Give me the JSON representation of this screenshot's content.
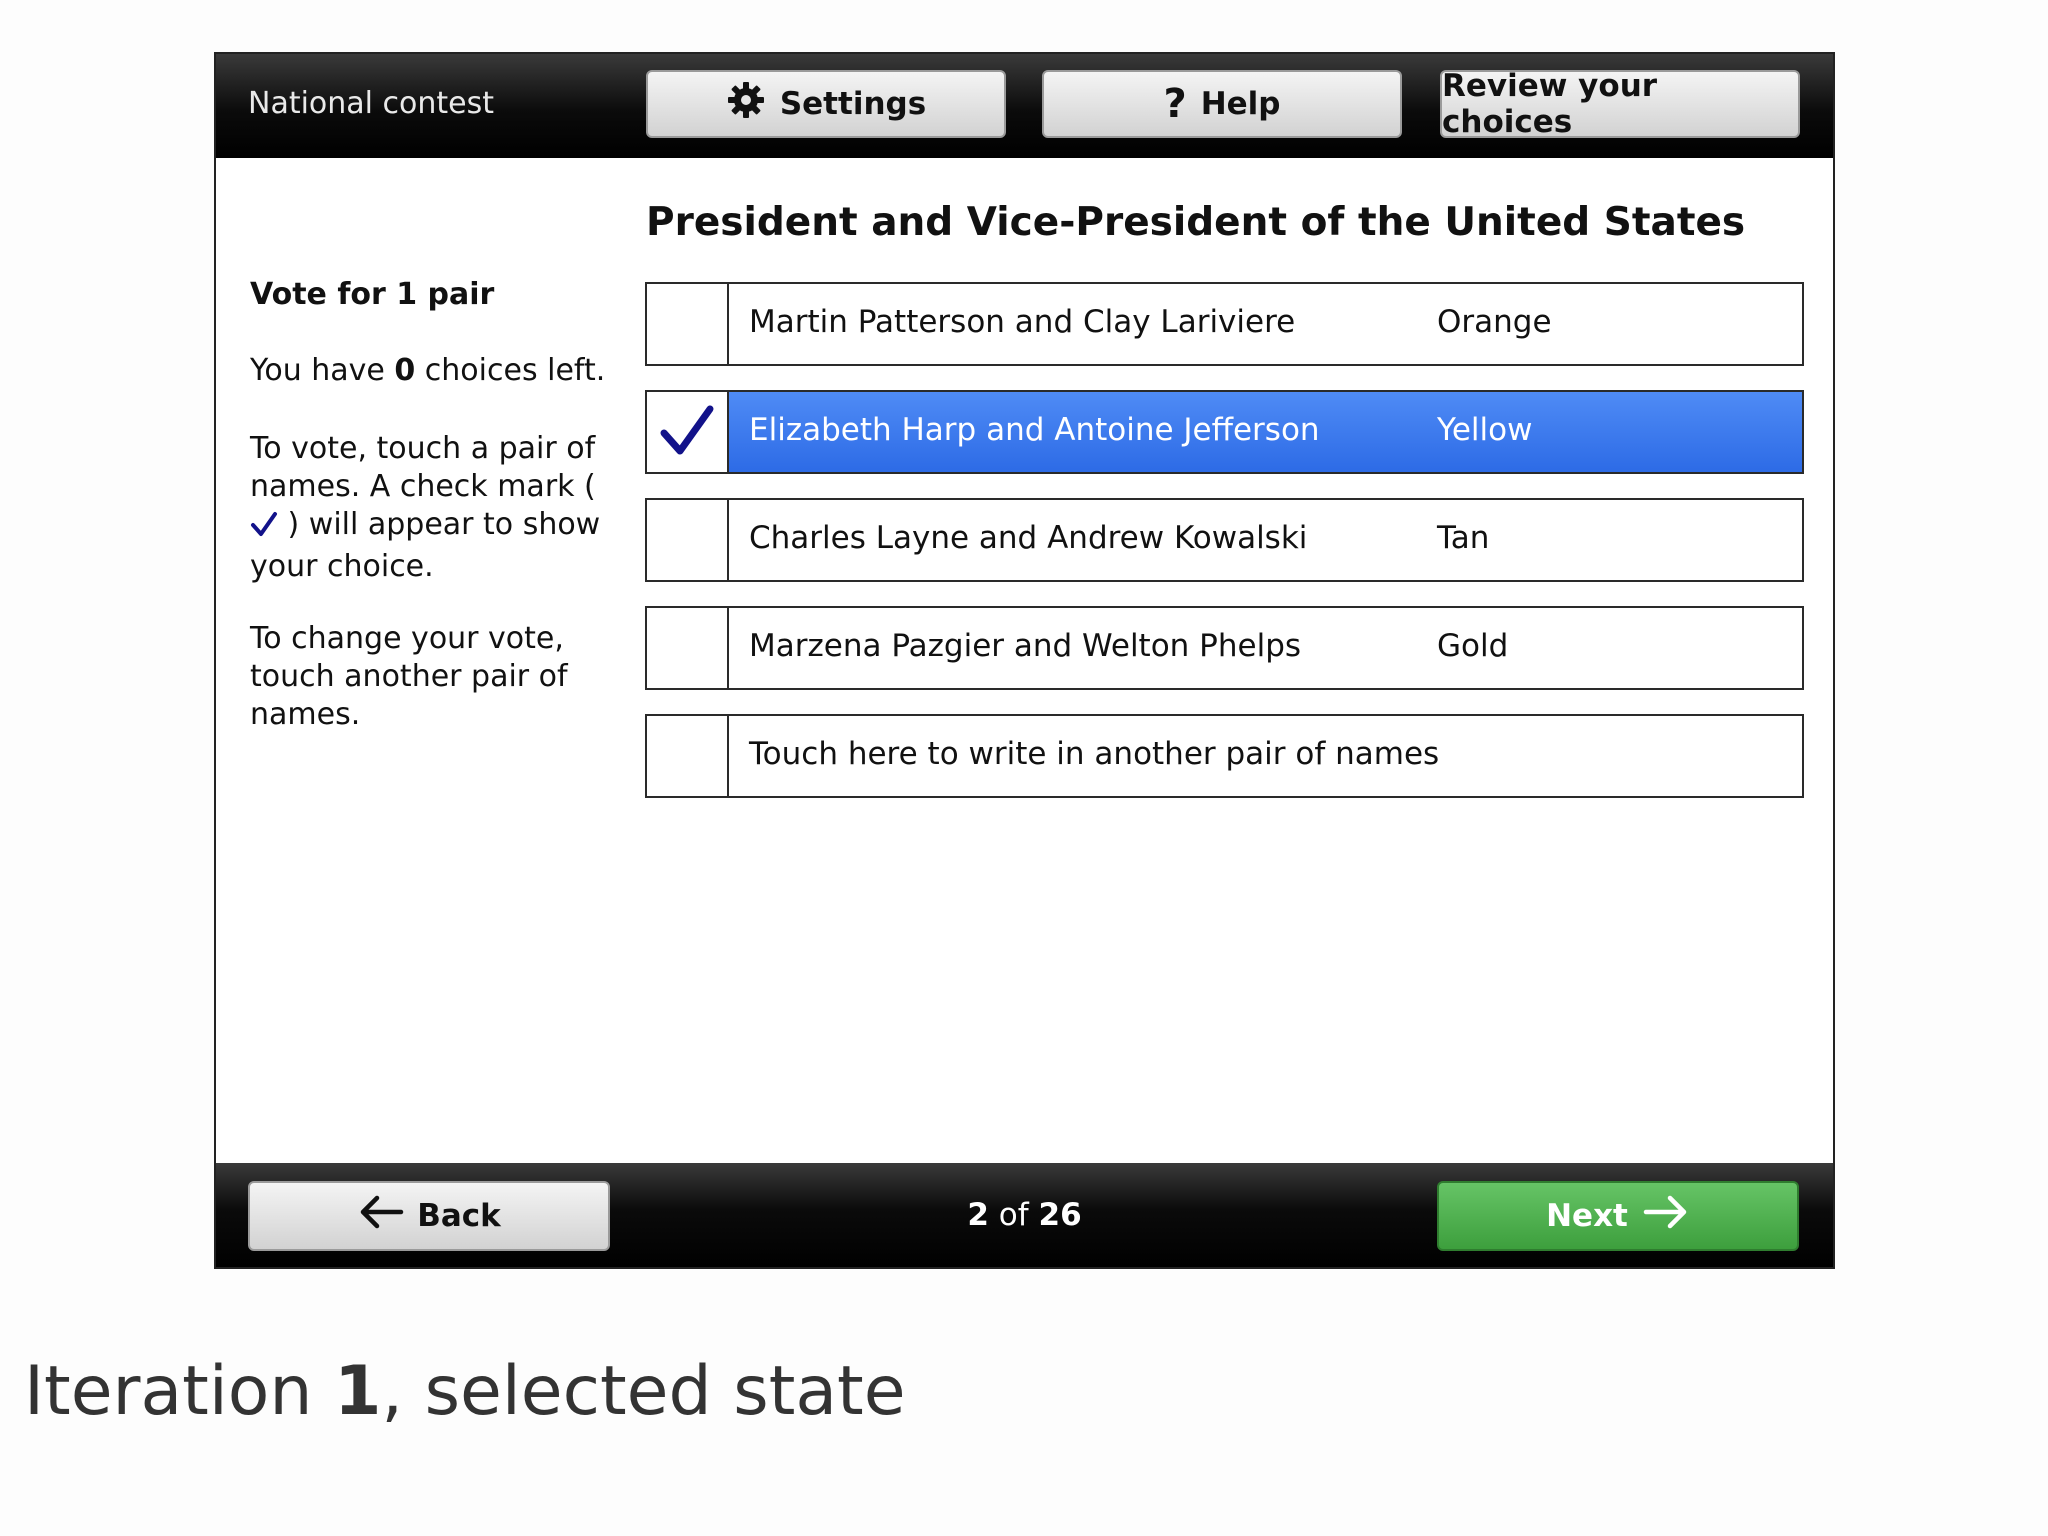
{
  "header": {
    "contest_label": "National contest",
    "settings_label": "Settings",
    "help_label": "Help",
    "review_label": "Review your choices"
  },
  "contest": {
    "title": "President and Vice-President of the United States"
  },
  "instructions": {
    "vote_for": "Vote for 1 pair",
    "choices_prefix": "You have ",
    "choices_left": "0",
    "choices_suffix": " choices left.",
    "touch_text_before": "To vote, touch a pair of names. A check mark ( ",
    "touch_text_after": " ) will appear to show your choice.",
    "change_text": "To change your vote, touch another pair of names."
  },
  "options": [
    {
      "names": "Martin Patterson and Clay Lariviere",
      "party": "Orange",
      "selected": false
    },
    {
      "names": "Elizabeth Harp and Antoine Jefferson",
      "party": "Yellow",
      "selected": true
    },
    {
      "names": "Charles Layne and Andrew Kowalski",
      "party": "Tan",
      "selected": false
    },
    {
      "names": "Marzena Pazgier and Welton Phelps",
      "party": "Gold",
      "selected": false
    },
    {
      "names": "Touch here to write in another pair of names",
      "party": "",
      "selected": false
    }
  ],
  "footer": {
    "back_label": "Back",
    "page_current": "2",
    "page_of": " of ",
    "page_total": "26",
    "next_label": "Next"
  },
  "caption": {
    "prefix": "Iteration ",
    "number": "1",
    "suffix": ", selected state"
  },
  "colors": {
    "selected_fill": "#2d6be6",
    "next_button": "#4cae4c",
    "check_mark": "#12128a"
  },
  "icons": [
    "gear-icon",
    "help-icon",
    "check-icon",
    "arrow-left-icon",
    "arrow-right-icon"
  ]
}
